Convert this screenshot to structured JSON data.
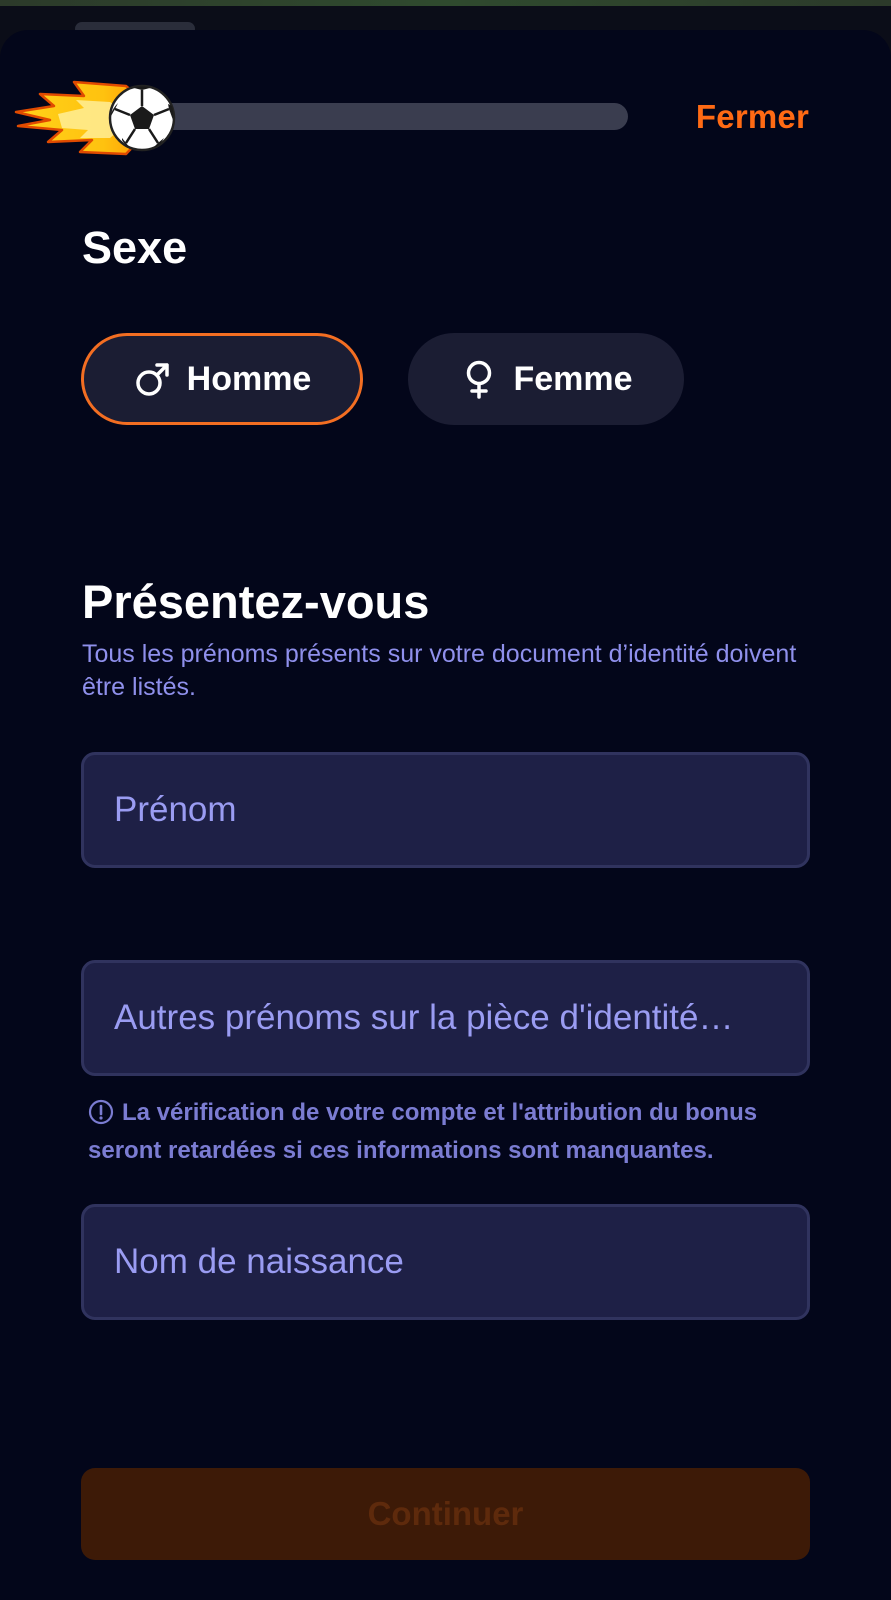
{
  "header": {
    "close_label": "Fermer",
    "progress_value": 0.0
  },
  "sex": {
    "title": "Sexe",
    "options": [
      {
        "label": "Homme",
        "icon": "male-icon",
        "selected": true
      },
      {
        "label": "Femme",
        "icon": "female-icon",
        "selected": false
      }
    ]
  },
  "intro": {
    "title": "Présentez-vous",
    "subtitle": "Tous les prénoms présents sur votre document d’identité doivent être listés."
  },
  "form": {
    "first_name": {
      "placeholder": "Prénom",
      "value": ""
    },
    "other_names": {
      "placeholder": "Autres prénoms sur la pièce d'identité…",
      "value": ""
    },
    "notice": "La vérification de votre compte et l'attribution du bonus seront retardées si ces informations sont manquantes.",
    "birth_name": {
      "placeholder": "Nom de naissance",
      "value": ""
    }
  },
  "actions": {
    "continue_label": "Continuer"
  },
  "colors": {
    "accent": "#ff6a14",
    "sheet_background": "#03061a",
    "field_background": "#1e2046",
    "placeholder": "#9a9cf2",
    "continue_disabled_bg": "#3d1a07"
  }
}
